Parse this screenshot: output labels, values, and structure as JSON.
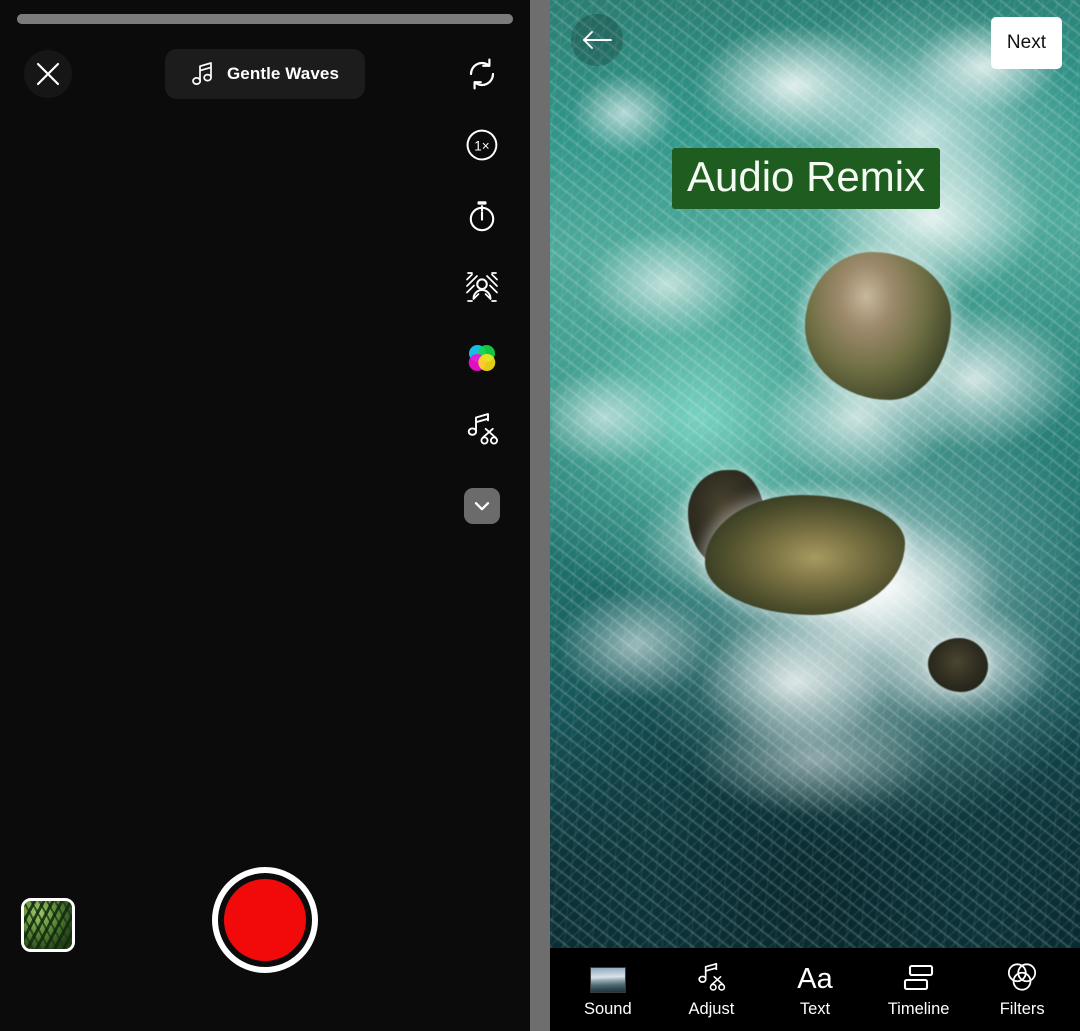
{
  "camera": {
    "progress_percent": 100,
    "close_icon": "close-icon",
    "music_chip": {
      "icon": "music-note-icon",
      "label": "Gentle Waves"
    },
    "tools": [
      {
        "icon": "flip-camera-icon",
        "name": "flip-camera"
      },
      {
        "icon": "speed-1x-icon",
        "name": "speed",
        "label": "1×"
      },
      {
        "icon": "timer-icon",
        "name": "timer"
      },
      {
        "icon": "retouch-icon",
        "name": "retouch"
      },
      {
        "icon": "color-filters-icon",
        "name": "filters"
      },
      {
        "icon": "trim-audio-icon",
        "name": "trim-audio"
      },
      {
        "icon": "chevron-down-icon",
        "name": "collapse-tools"
      }
    ],
    "gallery_thumbnail": "gallery-thumbnail-fern",
    "record_button": "record-button",
    "record_color": "#f20a0a"
  },
  "editor": {
    "back_icon": "arrow-left-icon",
    "next_label": "Next",
    "overlay_text": "Audio Remix",
    "overlay_bg_color": "#1e5c20",
    "overlay_text_color": "#f4fbf2",
    "preview": "aerial-ocean-rocks-video",
    "toolbar": [
      {
        "label": "Sound",
        "icon": "sound-thumbnail-icon"
      },
      {
        "label": "Adjust",
        "icon": "trim-audio-icon"
      },
      {
        "label": "Text",
        "icon": "text-aa-icon"
      },
      {
        "label": "Timeline",
        "icon": "timeline-icon"
      },
      {
        "label": "Filters",
        "icon": "filters-circles-icon"
      }
    ]
  }
}
